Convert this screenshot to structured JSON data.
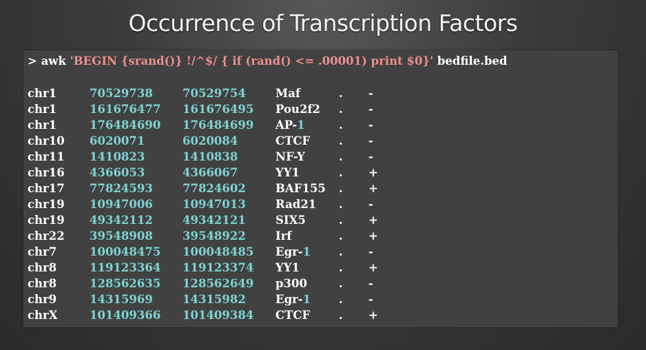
{
  "title": "Occurrence of Transcription Factors",
  "colors": {
    "numbers": "#7fd3d1",
    "script": "#e8908c",
    "text": "#ffffff",
    "terminal_bg": "#414141"
  },
  "command": {
    "prompt": ">",
    "program": "awk",
    "script": "'BEGIN {srand()} !/^$/ { if (rand() <= .00001) print $0}'",
    "file": "bedfile.bed"
  },
  "rows": [
    {
      "chrom": "chr1",
      "start": "70529738",
      "end": "70529754",
      "name": "Maf",
      "score": ".",
      "strand": "-"
    },
    {
      "chrom": "chr1",
      "start": "161676477",
      "end": "161676495",
      "name": "Pou2f2",
      "score": ".",
      "strand": "-"
    },
    {
      "chrom": "chr1",
      "start": "176484690",
      "end": "176484699",
      "name": "AP-1",
      "score": ".",
      "strand": "-"
    },
    {
      "chrom": "chr10",
      "start": "6020071",
      "end": "6020084",
      "name": "CTCF",
      "score": ".",
      "strand": "-"
    },
    {
      "chrom": "chr11",
      "start": "1410823",
      "end": "1410838",
      "name": "NF-Y",
      "score": ".",
      "strand": "-"
    },
    {
      "chrom": "chr16",
      "start": "4366053",
      "end": "4366067",
      "name": "YY1",
      "score": ".",
      "strand": "+"
    },
    {
      "chrom": "chr17",
      "start": "77824593",
      "end": "77824602",
      "name": "BAF155",
      "score": ".",
      "strand": "+"
    },
    {
      "chrom": "chr19",
      "start": "10947006",
      "end": "10947013",
      "name": "Rad21",
      "score": ".",
      "strand": "-"
    },
    {
      "chrom": "chr19",
      "start": "49342112",
      "end": "49342121",
      "name": "SIX5",
      "score": ".",
      "strand": "+"
    },
    {
      "chrom": "chr22",
      "start": "39548908",
      "end": "39548922",
      "name": "Irf",
      "score": ".",
      "strand": "+"
    },
    {
      "chrom": "chr7",
      "start": "100048475",
      "end": "100048485",
      "name": "Egr-1",
      "score": ".",
      "strand": "-"
    },
    {
      "chrom": "chr8",
      "start": "119123364",
      "end": "119123374",
      "name": "YY1",
      "score": ".",
      "strand": "+"
    },
    {
      "chrom": "chr8",
      "start": "128562635",
      "end": "128562649",
      "name": "p300",
      "score": ".",
      "strand": "-"
    },
    {
      "chrom": "chr9",
      "start": "14315969",
      "end": "14315982",
      "name": "Egr-1",
      "score": ".",
      "strand": "-"
    },
    {
      "chrom": "chrX",
      "start": "101409366",
      "end": "101409384",
      "name": "CTCF",
      "score": ".",
      "strand": "+"
    }
  ]
}
